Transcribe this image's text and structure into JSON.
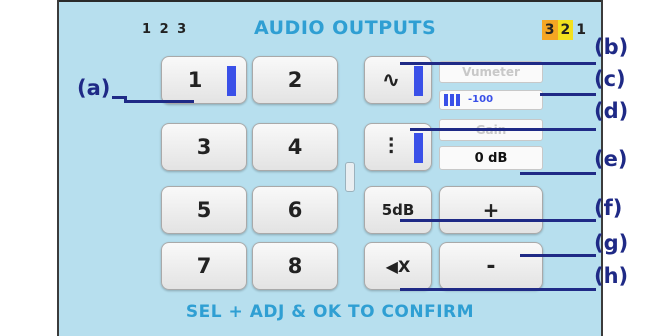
{
  "header": {
    "left_indicators": "1 2 3",
    "title": "AUDIO OUTPUTS",
    "right_indicators": [
      "3",
      "2",
      "1"
    ]
  },
  "keypad": [
    "1",
    "2",
    "3",
    "4",
    "5",
    "6",
    "7",
    "8"
  ],
  "controls": {
    "wave_icon": "∿",
    "mixer_icon": "⫶",
    "step_label": "5dB",
    "plus_label": "+",
    "minus_label": "-",
    "mute_icon": "◀X"
  },
  "fields": {
    "vumeter_label": "Vumeter",
    "vumeter_value": "-100",
    "gain_label": "Gain",
    "gain_value": "0 dB"
  },
  "footer": "SEL + ADJ & OK TO CONFIRM",
  "callouts": {
    "a": "(a)",
    "b": "(b)",
    "c": "(c)",
    "d": "(d)",
    "e": "(e)",
    "f": "(f)",
    "g": "(g)",
    "h": "(h)"
  },
  "colors": {
    "panel_bg": "#b7dfee",
    "accent_blue": "#3a50e8",
    "title_blue": "#2f9fd3",
    "callout_navy": "#1f2a86"
  }
}
